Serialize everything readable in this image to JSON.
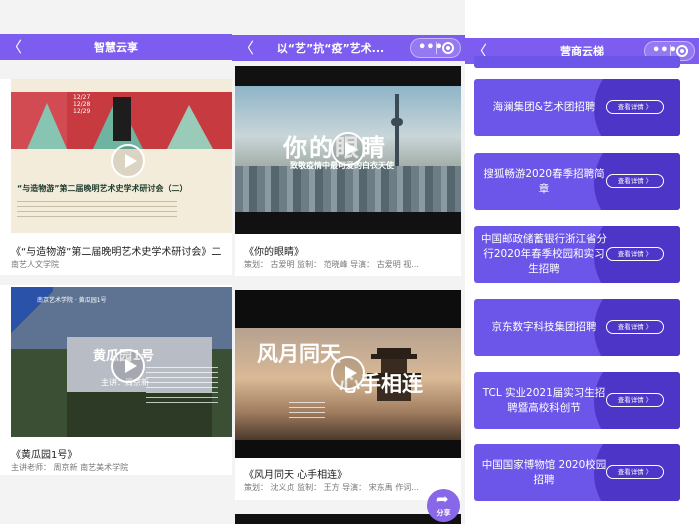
{
  "panel1": {
    "nav": {
      "back": "〈",
      "title": "智慧云享",
      "menu_dots": "•••"
    },
    "items": [
      {
        "title": "《“与造物游”第二届晚明艺术史学术研讨会》二",
        "author": "南艺人文学院",
        "thumb": {
          "dates": "12/27\n12/28\n12/29",
          "heading": "“与造物游”第二届晚明艺术史学术研讨会（二）"
        }
      },
      {
        "title": "《黄瓜园1号》",
        "author": "主讲老师：  周京新  南艺美术学院",
        "thumb": {
          "lines": "南京艺术学院 · 黄瓜园1号",
          "heading": "黄瓜园1号",
          "speaker": "主讲：周京新"
        }
      }
    ]
  },
  "panel2": {
    "nav": {
      "back": "〈",
      "title": "以“艺”抗“疫”艺术...",
      "menu_dots": "•••"
    },
    "items": [
      {
        "title": "《你的眼睛》",
        "credits": "策划：  古爱明  监制：  范晓峰  导演：  古爱明  视...",
        "thumb": {
          "heading": "你的眼睛",
          "subheading": "致敬疫情中最可爱的白衣天使"
        }
      },
      {
        "title": "《风月同天 心手相连》",
        "credits": "策划：  沈义贞  监制：  王方  导演：  宋东禹  作词...",
        "thumb": {
          "heading_left": "风月同天",
          "heading_right": "心手相连"
        }
      }
    ],
    "share": {
      "arrow": "➦",
      "label": "分享"
    }
  },
  "panel3": {
    "nav": {
      "back": "〈",
      "title": "营商云梯",
      "menu_dots": "•••"
    },
    "detail_label": "查看详情 〉",
    "jobs": [
      "海澜集团&艺术团招聘",
      "搜狐畅游2020春季招聘简章",
      "中国邮政储蓄银行浙江省分行2020年春季校园和实习生招聘",
      "京东数字科技集团招聘",
      "TCL 实业2021届实习生招聘暨高校科创节",
      "中国国家博物馆 2020校园招聘"
    ]
  }
}
